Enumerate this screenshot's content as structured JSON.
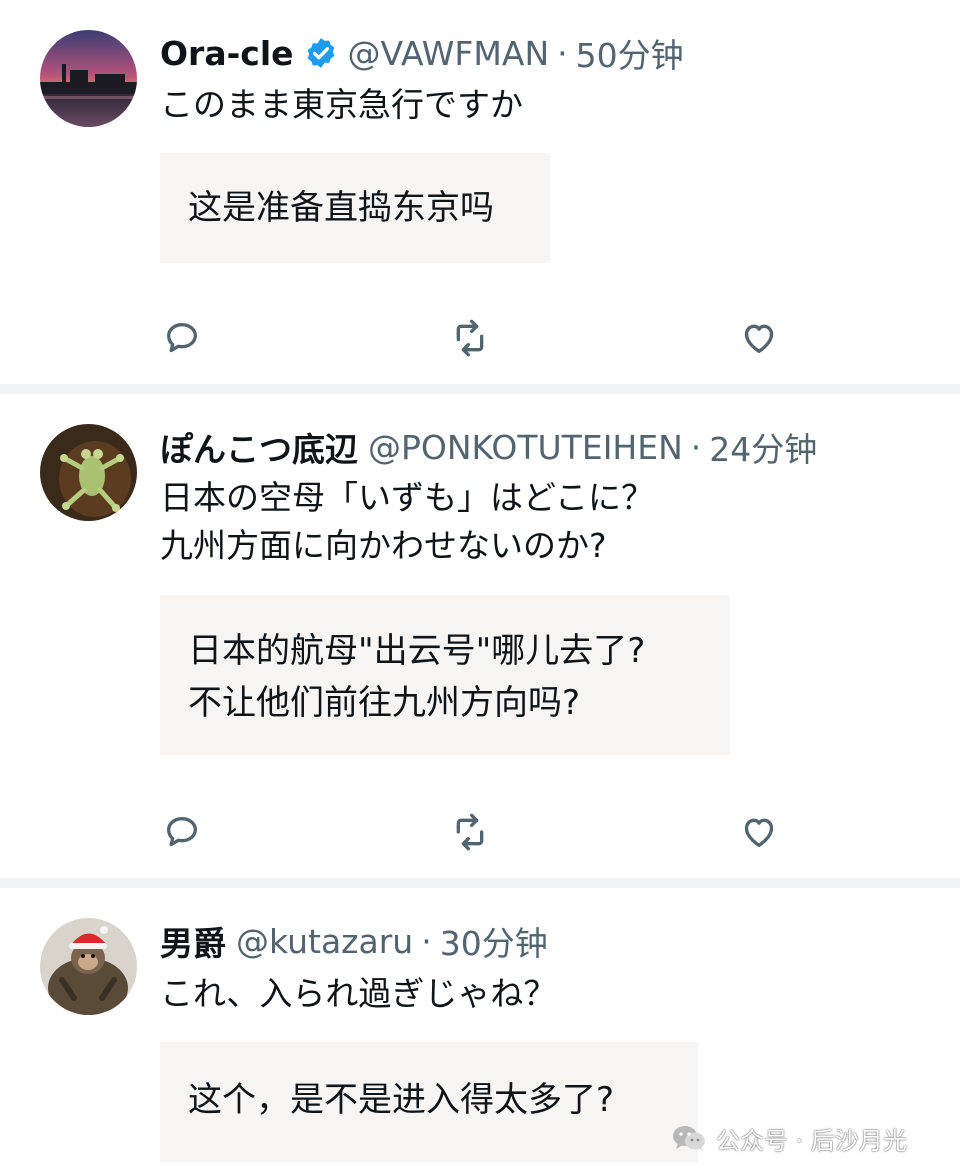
{
  "tweets": [
    {
      "name": "Ora-cle",
      "verified": true,
      "handle": "@VAWFMAN",
      "separator": "·",
      "time": "50分钟",
      "text_lines": [
        "このまま東京急行ですか"
      ],
      "translation_lines": [
        "这是准备直捣东京吗"
      ],
      "avatar_icon": "sunset-ship-avatar"
    },
    {
      "name": "ぽんこつ底辺",
      "verified": false,
      "handle": "@PONKOTUTEIHEN",
      "separator": "·",
      "time": "24分钟",
      "text_lines": [
        "日本の空母「いずも」はどこに？",
        "九州方面に向かわせないのか?"
      ],
      "translation_lines": [
        "日本的航母\"出云号\"哪儿去了?",
        "不让他们前往九州方向吗?"
      ],
      "avatar_icon": "frog-avatar"
    },
    {
      "name": "男爵",
      "verified": false,
      "handle": "@kutazaru",
      "separator": "·",
      "time": "30分钟",
      "text_lines": [
        "これ、入られ過ぎじゃね？"
      ],
      "translation_lines": [
        "这个，是不是进入得太多了?"
      ],
      "avatar_icon": "monkey-santa-hat-avatar"
    }
  ],
  "watermark": {
    "text": "公众号 · 后沙月光",
    "icon": "wechat-icon"
  },
  "colors": {
    "verified_badge": "#1d9bf0",
    "secondary_text": "#536471",
    "action_icon": "#536471",
    "translation_bg": "#f7f5f3",
    "divider": "#f2f3f4"
  }
}
